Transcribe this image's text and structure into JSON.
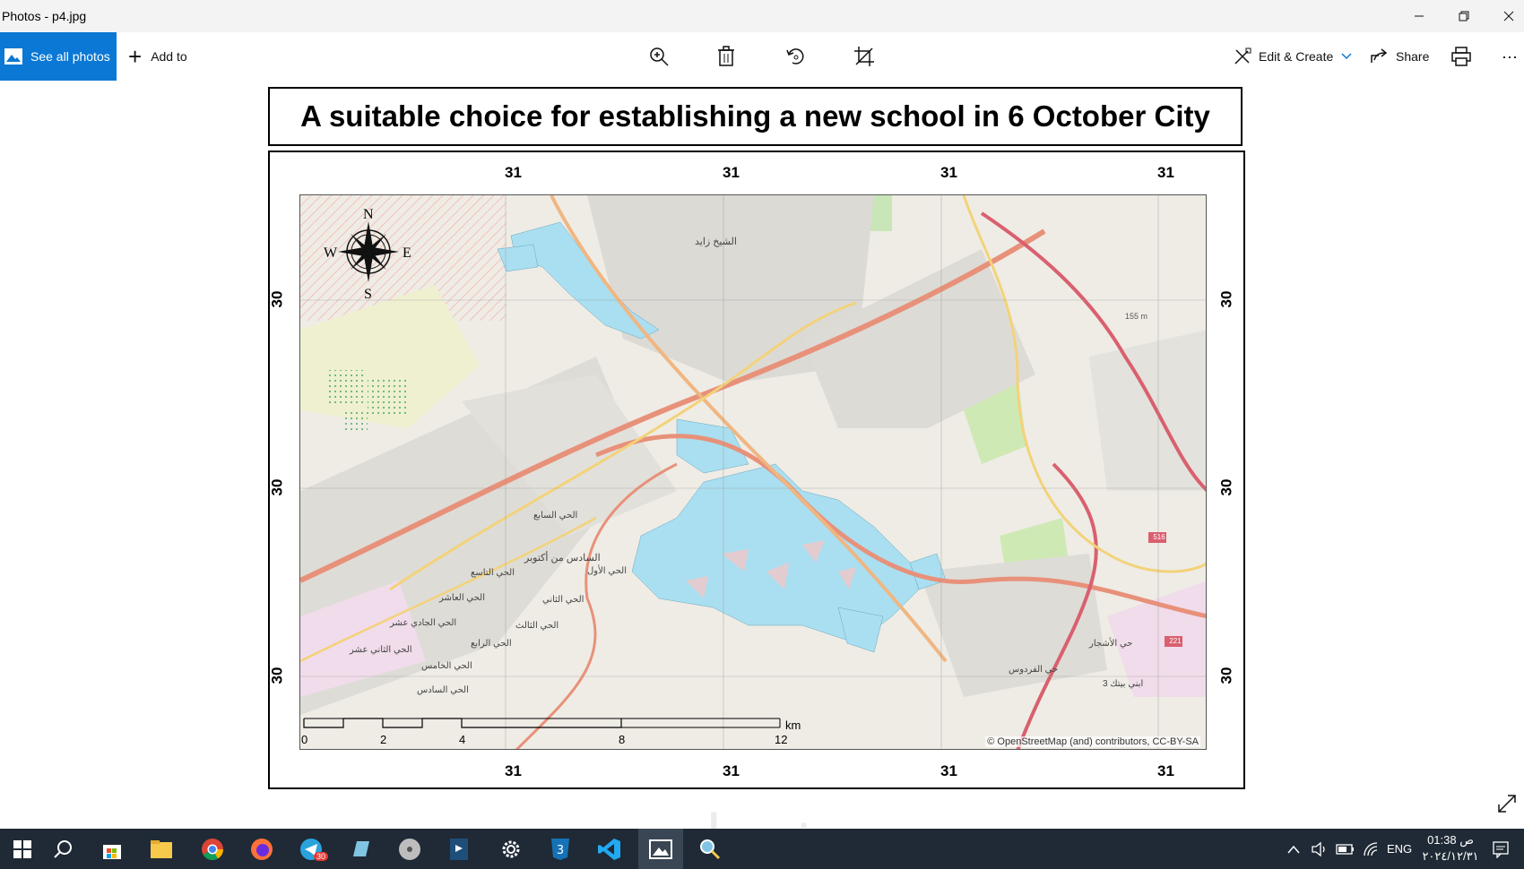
{
  "window": {
    "title": "Photos - p4.jpg",
    "minimize_icon": "minimize-icon",
    "restore_icon": "restore-icon",
    "close_icon": "close-icon"
  },
  "toolbar": {
    "see_all_label": "See all photos",
    "add_to_label": "Add to",
    "edit_create_label": "Edit & Create",
    "share_label": "Share",
    "more_label": "···"
  },
  "map": {
    "title": "A suitable choice for establishing a new school in 6 October City",
    "top_ticks": [
      "31",
      "31",
      "31",
      "31"
    ],
    "bottom_ticks": [
      "31",
      "31",
      "31",
      "31"
    ],
    "left_ticks": [
      "30",
      "30",
      "30"
    ],
    "right_ticks": [
      "30",
      "30",
      "30"
    ],
    "compass": {
      "n": "N",
      "s": "S",
      "e": "E",
      "w": "W"
    },
    "scale": {
      "labels": [
        "0",
        "2",
        "4",
        "8",
        "12"
      ],
      "unit": "km"
    },
    "attribution": "© OpenStreetMap (and) contributors, CC-BY-SA",
    "place_labels": [
      "الشيخ زايد",
      "الحي السابع",
      "السادس من أكتوبر",
      "الحي الأول",
      "الحي العاشر",
      "الحي الثاني",
      "الحي الثالث",
      "الحي الرابع",
      "الحي الخامس",
      "الحي السادس",
      "حي الأشجار",
      "حي الفردوس",
      "ابني بيتك 3",
      "الحي الجادي عشر",
      "الحي الثاني عشر",
      "الحي التاسع",
      "155 m"
    ],
    "road_badges": [
      "516",
      "221"
    ],
    "colors": {
      "suitable_area": "#a9dff0",
      "map_bg": "#efece5",
      "primary_road": "#e8917a",
      "trunk_road": "#d9606f",
      "secondary_road": "#f3d27a"
    }
  },
  "taskbar": {
    "telegram_badge": "30",
    "lang": "ENG",
    "time": "01:38 ص",
    "date": "٢٠٢٤/١٢/٣١"
  },
  "watermark": "خمسات"
}
